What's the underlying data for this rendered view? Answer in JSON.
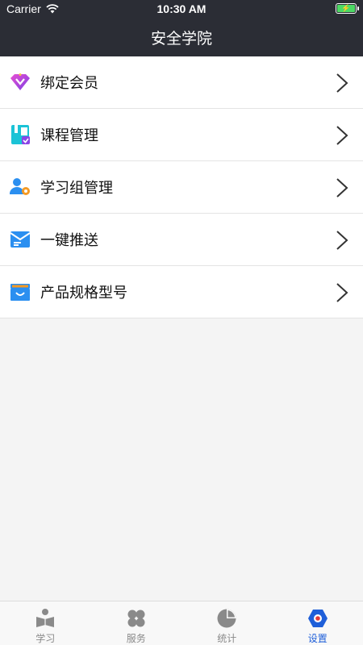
{
  "status_bar": {
    "carrier": "Carrier",
    "time": "10:30 AM"
  },
  "nav": {
    "title": "安全学院"
  },
  "menu": {
    "items": [
      {
        "label": "绑定会员",
        "icon": "vip-diamond-icon"
      },
      {
        "label": "课程管理",
        "icon": "course-book-icon"
      },
      {
        "label": "学习组管理",
        "icon": "group-settings-icon"
      },
      {
        "label": "一键推送",
        "icon": "push-mail-icon"
      },
      {
        "label": "产品规格型号",
        "icon": "product-box-icon"
      }
    ]
  },
  "tab_bar": {
    "tabs": [
      {
        "label": "学习",
        "icon": "study-icon",
        "active": false
      },
      {
        "label": "服务",
        "icon": "service-icon",
        "active": false
      },
      {
        "label": "统计",
        "icon": "statistics-icon",
        "active": false
      },
      {
        "label": "设置",
        "icon": "settings-icon",
        "active": true
      }
    ]
  },
  "colors": {
    "header_bg": "#2b2d35",
    "accent": "#1f5fd9",
    "page_bg": "#f4f4f4"
  }
}
